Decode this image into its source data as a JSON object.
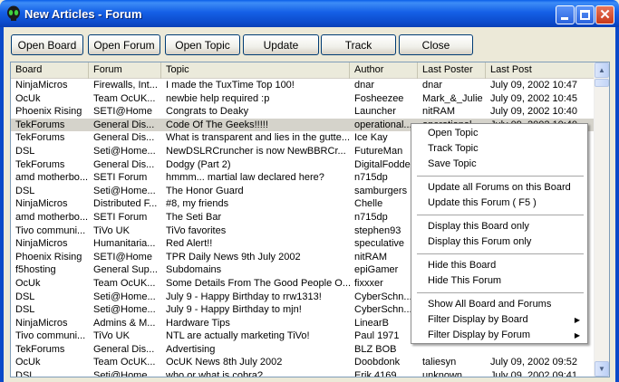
{
  "window": {
    "title": "New Articles - Forum"
  },
  "toolbar": {
    "open_board": "Open Board",
    "open_forum": "Open Forum",
    "open_topic": "Open Topic",
    "update": "Update",
    "track": "Track",
    "close": "Close"
  },
  "columns": [
    "Board",
    "Forum",
    "Topic",
    "Author",
    "Last Poster",
    "Last Post"
  ],
  "rows": [
    [
      "NinjaMicros",
      "Firewalls, Int...",
      "I made the TuxTime Top 100!",
      "dnar",
      "dnar",
      "July 09, 2002 10:47"
    ],
    [
      "OcUk",
      "Team OcUK...",
      "newbie help required :p",
      "Fosheezee",
      "Mark_&_Julie",
      "July 09, 2002 10:45"
    ],
    [
      "Phoenix Rising",
      "SETI@Home",
      "Congrats to Deaky",
      "Launcher",
      "nitRAM",
      "July 09, 2002 10:40"
    ],
    [
      "TekForums",
      "General Dis...",
      "Code Of The Geeks!!!!!",
      "operational...",
      "operational",
      "July 09, 2002 10:40"
    ],
    [
      "TekForums",
      "General Dis...",
      "What is transparent and lies in the gutte...",
      "Ice Kay",
      "",
      ""
    ],
    [
      "DSL",
      "Seti@Home...",
      "NewDSLRCruncher is now NewBBRCr...",
      "FutureMan",
      "",
      ""
    ],
    [
      "TekForums",
      "General Dis...",
      "Dodgy (Part 2)",
      "DigitalFodder",
      "",
      ""
    ],
    [
      "amd motherbo...",
      "SETI Forum",
      "hmmm... martial law declared here?",
      "n715dp",
      "",
      ""
    ],
    [
      "DSL",
      "Seti@Home...",
      "The Honor Guard",
      "samburgers",
      "",
      ""
    ],
    [
      "NinjaMicros",
      "Distributed F...",
      "#8, my friends",
      "Chelle",
      "",
      ""
    ],
    [
      "amd motherbo...",
      "SETI Forum",
      "The Seti Bar",
      "n715dp",
      "",
      ""
    ],
    [
      "Tivo communi...",
      "TiVo UK",
      "TiVo favorites",
      "stephen93",
      "",
      ""
    ],
    [
      "NinjaMicros",
      "Humanitaria...",
      "Red Alert!!",
      "speculative",
      "",
      ""
    ],
    [
      "Phoenix Rising",
      "SETI@Home",
      "TPR Daily News 9th July 2002",
      "nitRAM",
      "",
      ""
    ],
    [
      "f5hosting",
      "General Sup...",
      "Subdomains",
      "epiGamer",
      "",
      ""
    ],
    [
      "OcUk",
      "Team OcUK...",
      "Some Details From The Good People O...",
      "fixxxer",
      "",
      ""
    ],
    [
      "DSL",
      "Seti@Home...",
      "July 9 - Happy Birthday to rrw1313!",
      "CyberSchn...",
      "",
      ""
    ],
    [
      "DSL",
      "Seti@Home...",
      "July 9 - Happy Birthday to mjn!",
      "CyberSchn...",
      "",
      ""
    ],
    [
      "NinjaMicros",
      "Admins & M...",
      "Hardware Tips",
      "LinearB",
      "",
      ""
    ],
    [
      "Tivo communi...",
      "TiVo UK",
      "NTL are actually marketing TiVo!",
      "Paul 1971",
      "",
      ""
    ],
    [
      "TekForums",
      "General Dis...",
      "Advertising",
      "BLZ BOB",
      "",
      ""
    ],
    [
      "OcUk",
      "Team OcUK...",
      "OcUK News 8th July 2002",
      "Doobdonk",
      "taliesyn",
      "July 09, 2002 09:52"
    ],
    [
      "DSL",
      "Seti@Home...",
      "who or what is cobra?",
      "Erik 4169",
      "unknown",
      "July 09, 2002 09:41"
    ]
  ],
  "context_menu": {
    "open_topic": "Open Topic",
    "track_topic": "Track Topic",
    "save_topic": "Save Topic",
    "update_all_forums": "Update all Forums on this Board",
    "update_this_forum": "Update this Forum ( F5 )",
    "display_board_only": "Display this Board only",
    "display_forum_only": "Display this Forum only",
    "hide_board": "Hide this Board",
    "hide_forum": "Hide This Forum",
    "show_all": "Show All Board and Forums",
    "filter_board": "Filter Display by Board",
    "filter_forum": "Filter Display by Forum"
  },
  "icons": {
    "app": "alien-head-icon",
    "submenu": "submenu-arrow-icon"
  },
  "colors": {
    "titlebar": "#0b49c9",
    "selected_row": "#d5d3cb"
  }
}
